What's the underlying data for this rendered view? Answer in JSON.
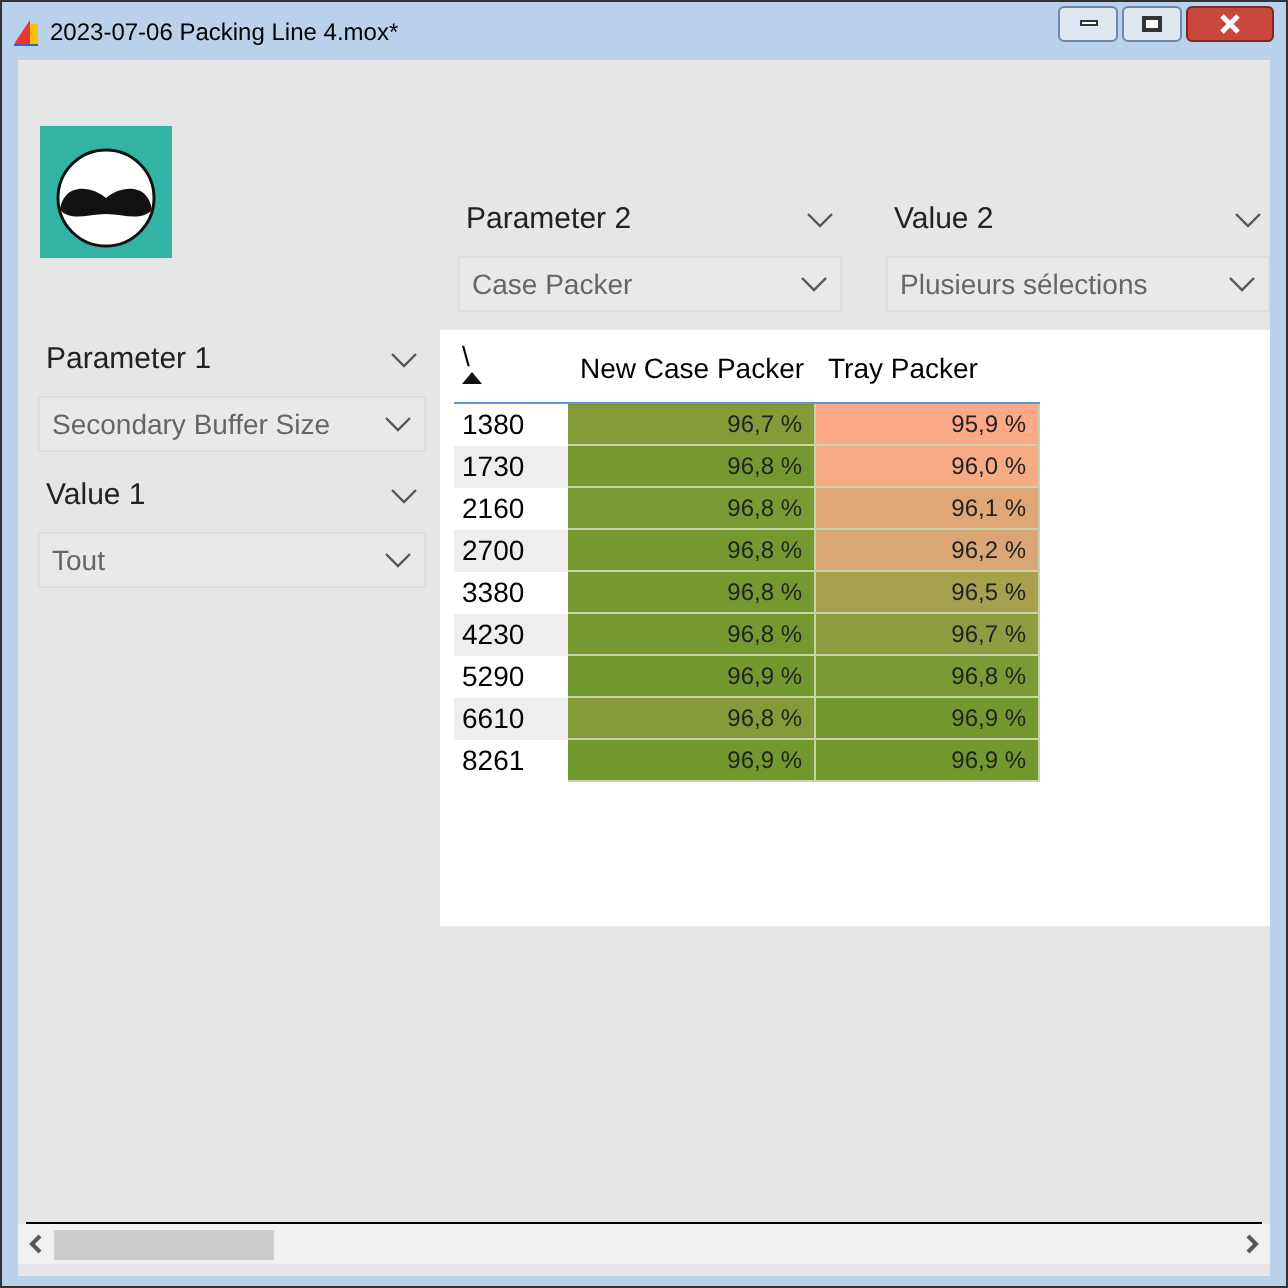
{
  "window": {
    "title": "2023-07-06 Packing Line 4.mox*"
  },
  "filters": [
    {
      "label": "Parameter 2",
      "value": "Case Packer"
    },
    {
      "label": "Value 2",
      "value": "Plusieurs sélections"
    },
    {
      "label": "Parameter 1",
      "value": "Secondary Buffer Size"
    },
    {
      "label": "Value 1",
      "value": "Tout"
    }
  ],
  "table": {
    "corner": "\\",
    "columns": [
      "New Case Packer",
      "Tray Packer"
    ],
    "rows": [
      {
        "label": "1380",
        "cells": [
          {
            "text": "96,7 %",
            "color": "#839a37"
          },
          {
            "text": "95,9 %",
            "color": "#fda987"
          }
        ]
      },
      {
        "label": "1730",
        "cells": [
          {
            "text": "96,8 %",
            "color": "#76992f"
          },
          {
            "text": "96,0 %",
            "color": "#f7ab85"
          }
        ]
      },
      {
        "label": "2160",
        "cells": [
          {
            "text": "96,8 %",
            "color": "#7b9a34"
          },
          {
            "text": "96,1 %",
            "color": "#dfa677"
          }
        ]
      },
      {
        "label": "2700",
        "cells": [
          {
            "text": "96,8 %",
            "color": "#76992f"
          },
          {
            "text": "96,2 %",
            "color": "#d9a776"
          }
        ]
      },
      {
        "label": "3380",
        "cells": [
          {
            "text": "96,8 %",
            "color": "#76992f"
          },
          {
            "text": "96,5 %",
            "color": "#a9a04f"
          }
        ]
      },
      {
        "label": "4230",
        "cells": [
          {
            "text": "96,8 %",
            "color": "#76992f"
          },
          {
            "text": "96,7 %",
            "color": "#8f9d40"
          }
        ]
      },
      {
        "label": "5290",
        "cells": [
          {
            "text": "96,9 %",
            "color": "#72992d"
          },
          {
            "text": "96,8 %",
            "color": "#7b9a34"
          }
        ]
      },
      {
        "label": "6610",
        "cells": [
          {
            "text": "96,8 %",
            "color": "#839a37"
          },
          {
            "text": "96,9 %",
            "color": "#72992d"
          }
        ]
      },
      {
        "label": "8261",
        "cells": [
          {
            "text": "96,9 %",
            "color": "#72992d"
          },
          {
            "text": "96,9 %",
            "color": "#72992d"
          }
        ]
      }
    ]
  }
}
